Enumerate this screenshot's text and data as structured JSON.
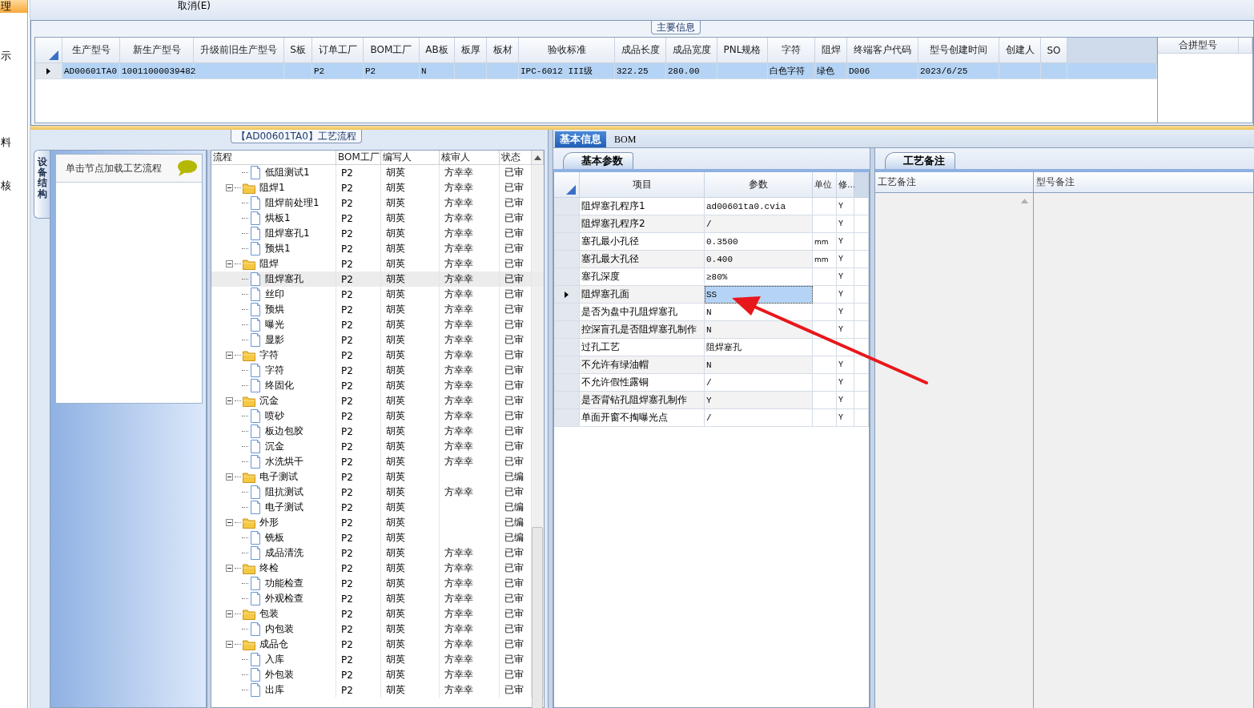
{
  "side_menu": [
    {
      "label": "理",
      "selected": true
    },
    {
      "label": "示",
      "selected": false
    },
    {
      "label": "料",
      "selected": false
    },
    {
      "label": "核",
      "selected": false
    }
  ],
  "toolbar": {
    "buttons": [
      "取消(E)"
    ]
  },
  "main_info": {
    "title": "主要信息",
    "columns": [
      "生产型号",
      "新生产型号",
      "升级前旧生产型号",
      "S板",
      "订单工厂",
      "BOM工厂",
      "AB板",
      "板厚",
      "板材",
      "验收标准",
      "成品长度",
      "成品宽度",
      "PNL规格",
      "字符",
      "阻焊",
      "终端客户代码",
      "型号创建时间",
      "创建人",
      "SO"
    ],
    "rows": [
      {
        "selected": true,
        "cells": [
          "AD00601TA0",
          "10011000039482",
          null,
          null,
          "P2",
          "P2",
          "N",
          null,
          null,
          "IPC-6012 III级",
          "322.25",
          "280.00",
          null,
          "白色字符",
          "绿色",
          "D006",
          "2023/6/25",
          null,
          null
        ]
      }
    ]
  },
  "merge_panel": {
    "column": "合拼型号"
  },
  "flow": {
    "title": "【AD00601TA0】工艺流程",
    "side_tab": "设备结构",
    "side_header": "单击节点加载工艺流程",
    "columns": [
      "流程",
      "BOM工厂",
      "编写人",
      "核审人",
      "状态"
    ],
    "nodes": [
      {
        "kind": "file",
        "name": "低阻测试1",
        "bom": "P2",
        "writer": "胡英",
        "reviewer": "方幸幸",
        "status": "已审",
        "selected": false
      },
      {
        "kind": "folder",
        "name": "阻焊1",
        "bom": "P2",
        "writer": "胡英",
        "reviewer": "方幸幸",
        "status": "已审",
        "selected": false,
        "expanded": true,
        "children": [
          {
            "kind": "file",
            "name": "阻焊前处理1",
            "bom": "P2",
            "writer": "胡英",
            "reviewer": "方幸幸",
            "status": "已审",
            "selected": false
          },
          {
            "kind": "file",
            "name": "烘板1",
            "bom": "P2",
            "writer": "胡英",
            "reviewer": "方幸幸",
            "status": "已审",
            "selected": false
          },
          {
            "kind": "file",
            "name": "阻焊塞孔1",
            "bom": "P2",
            "writer": "胡英",
            "reviewer": "方幸幸",
            "status": "已审",
            "selected": false
          },
          {
            "kind": "file",
            "name": "预烘1",
            "bom": "P2",
            "writer": "胡英",
            "reviewer": "方幸幸",
            "status": "已审",
            "selected": false
          }
        ]
      },
      {
        "kind": "folder",
        "name": "阻焊",
        "bom": "P2",
        "writer": "胡英",
        "reviewer": "方幸幸",
        "status": "已审",
        "selected": false,
        "expanded": true,
        "children": [
          {
            "kind": "file",
            "name": "阻焊塞孔",
            "bom": "P2",
            "writer": "胡英",
            "reviewer": "方幸幸",
            "status": "已审",
            "selected": true
          },
          {
            "kind": "file",
            "name": "丝印",
            "bom": "P2",
            "writer": "胡英",
            "reviewer": "方幸幸",
            "status": "已审",
            "selected": false
          },
          {
            "kind": "file",
            "name": "预烘",
            "bom": "P2",
            "writer": "胡英",
            "reviewer": "方幸幸",
            "status": "已审",
            "selected": false
          },
          {
            "kind": "file",
            "name": "曝光",
            "bom": "P2",
            "writer": "胡英",
            "reviewer": "方幸幸",
            "status": "已审",
            "selected": false
          },
          {
            "kind": "file",
            "name": "显影",
            "bom": "P2",
            "writer": "胡英",
            "reviewer": "方幸幸",
            "status": "已审",
            "selected": false
          }
        ]
      },
      {
        "kind": "folder",
        "name": "字符",
        "bom": "P2",
        "writer": "胡英",
        "reviewer": "方幸幸",
        "status": "已审",
        "selected": false,
        "expanded": true,
        "children": [
          {
            "kind": "file",
            "name": "字符",
            "bom": "P2",
            "writer": "胡英",
            "reviewer": "方幸幸",
            "status": "已审",
            "selected": false
          },
          {
            "kind": "file",
            "name": "终固化",
            "bom": "P2",
            "writer": "胡英",
            "reviewer": "方幸幸",
            "status": "已审",
            "selected": false
          }
        ]
      },
      {
        "kind": "folder",
        "name": "沉金",
        "bom": "P2",
        "writer": "胡英",
        "reviewer": "方幸幸",
        "status": "已审",
        "selected": false,
        "expanded": true,
        "children": [
          {
            "kind": "file",
            "name": "喷砂",
            "bom": "P2",
            "writer": "胡英",
            "reviewer": "方幸幸",
            "status": "已审",
            "selected": false
          },
          {
            "kind": "file",
            "name": "板边包胶",
            "bom": "P2",
            "writer": "胡英",
            "reviewer": "方幸幸",
            "status": "已审",
            "selected": false
          },
          {
            "kind": "file",
            "name": "沉金",
            "bom": "P2",
            "writer": "胡英",
            "reviewer": "方幸幸",
            "status": "已审",
            "selected": false
          },
          {
            "kind": "file",
            "name": "水洗烘干",
            "bom": "P2",
            "writer": "胡英",
            "reviewer": "方幸幸",
            "status": "已审",
            "selected": false
          }
        ]
      },
      {
        "kind": "folder",
        "name": "电子测试",
        "bom": "P2",
        "writer": "胡英",
        "status": "已编",
        "selected": false,
        "expanded": true,
        "children": [
          {
            "kind": "file",
            "name": "阻抗测试",
            "bom": "P2",
            "writer": "胡英",
            "reviewer": "方幸幸",
            "status": "已审",
            "selected": false
          },
          {
            "kind": "file",
            "name": "电子测试",
            "bom": "P2",
            "writer": "胡英",
            "status": "已编",
            "selected": false
          }
        ]
      },
      {
        "kind": "folder",
        "name": "外形",
        "bom": "P2",
        "writer": "胡英",
        "status": "已编",
        "selected": false,
        "expanded": true,
        "children": [
          {
            "kind": "file",
            "name": "铣板",
            "bom": "P2",
            "writer": "胡英",
            "status": "已编",
            "selected": false
          },
          {
            "kind": "file",
            "name": "成品清洗",
            "bom": "P2",
            "writer": "胡英",
            "reviewer": "方幸幸",
            "status": "已审",
            "selected": false
          }
        ]
      },
      {
        "kind": "folder",
        "name": "终检",
        "bom": "P2",
        "writer": "胡英",
        "reviewer": "方幸幸",
        "status": "已审",
        "selected": false,
        "expanded": true,
        "children": [
          {
            "kind": "file",
            "name": "功能检查",
            "bom": "P2",
            "writer": "胡英",
            "reviewer": "方幸幸",
            "status": "已审",
            "selected": false
          },
          {
            "kind": "file",
            "name": "外观检查",
            "bom": "P2",
            "writer": "胡英",
            "reviewer": "方幸幸",
            "status": "已审",
            "selected": false
          }
        ]
      },
      {
        "kind": "folder",
        "name": "包装",
        "bom": "P2",
        "writer": "胡英",
        "reviewer": "方幸幸",
        "status": "已审",
        "selected": false,
        "expanded": true,
        "children": [
          {
            "kind": "file",
            "name": "内包装",
            "bom": "P2",
            "writer": "胡英",
            "reviewer": "方幸幸",
            "status": "已审",
            "selected": false
          }
        ]
      },
      {
        "kind": "folder",
        "name": "成品仓",
        "bom": "P2",
        "writer": "胡英",
        "reviewer": "方幸幸",
        "status": "已审",
        "selected": false,
        "expanded": true,
        "children": [
          {
            "kind": "file",
            "name": "入库",
            "bom": "P2",
            "writer": "胡英",
            "reviewer": "方幸幸",
            "status": "已审",
            "selected": false
          },
          {
            "kind": "file",
            "name": "外包装",
            "bom": "P2",
            "writer": "胡英",
            "reviewer": "方幸幸",
            "status": "已审",
            "selected": false
          },
          {
            "kind": "file",
            "name": "出库",
            "bom": "P2",
            "writer": "胡英",
            "reviewer": "方幸幸",
            "status": "已审",
            "selected": false
          }
        ]
      }
    ]
  },
  "detail_tabs": [
    {
      "label": "基本信息",
      "selected": true
    },
    {
      "label": "BOM",
      "selected": false
    }
  ],
  "params": {
    "tab": "基本参数",
    "columns": [
      "项目",
      "参数",
      "单位",
      "修..."
    ],
    "rows": [
      {
        "item": "阻焊塞孔程序1",
        "value": "ad00601ta0.cvia",
        "flag": "Y",
        "selected": false
      },
      {
        "item": "阻焊塞孔程序2",
        "value": "/",
        "flag": "Y",
        "selected": false
      },
      {
        "item": "塞孔最小孔径",
        "value": "0.3500",
        "unit": "mm",
        "flag": "Y",
        "selected": false
      },
      {
        "item": "塞孔最大孔径",
        "value": "0.400",
        "unit": "mm",
        "flag": "Y",
        "selected": false
      },
      {
        "item": "塞孔深度",
        "value": "≥80%",
        "flag": "Y",
        "selected": false
      },
      {
        "item": "阻焊塞孔面",
        "value": "SS",
        "flag": "Y",
        "selected": true
      },
      {
        "item": "是否为盘中孔阻焊塞孔",
        "value": "N",
        "flag": "Y",
        "selected": false
      },
      {
        "item": "控深盲孔是否阻焊塞孔制作",
        "value": "N",
        "flag": "Y",
        "selected": false
      },
      {
        "item": "过孔工艺",
        "value": "阻焊塞孔",
        "selected": false
      },
      {
        "item": "不允许有绿油帽",
        "value": "N",
        "flag": "Y",
        "selected": false
      },
      {
        "item": "不允许假性露铜",
        "value": "/",
        "flag": "Y",
        "selected": false
      },
      {
        "item": "是否背钻孔阻焊塞孔制作",
        "value": "Y",
        "flag": "Y",
        "selected": false
      },
      {
        "item": "单面开窗不掏曝光点",
        "value": "/",
        "flag": "Y",
        "selected": false
      }
    ]
  },
  "notes": {
    "tab": "工艺备注",
    "columns": [
      "工艺备注",
      "型号备注"
    ]
  },
  "annotation": {
    "kind": "arrow"
  }
}
